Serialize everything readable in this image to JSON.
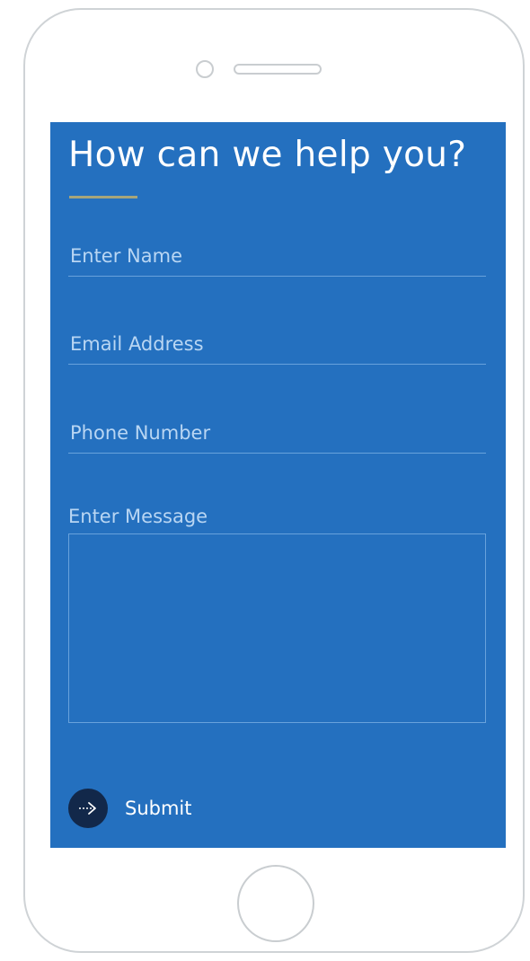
{
  "form": {
    "title": "How can we help you?",
    "name_placeholder": "Enter Name",
    "email_placeholder": "Email Address",
    "phone_placeholder": "Phone Number",
    "message_label": "Enter Message",
    "message_value": "",
    "submit_label": "Submit",
    "submit_icon": "arrow-right-icon"
  },
  "colors": {
    "screen_background": "#2470bf",
    "accent_underline": "#a6a57a",
    "submit_circle": "#12284a",
    "field_line": "#68a2dc",
    "text": "#ffffff"
  }
}
